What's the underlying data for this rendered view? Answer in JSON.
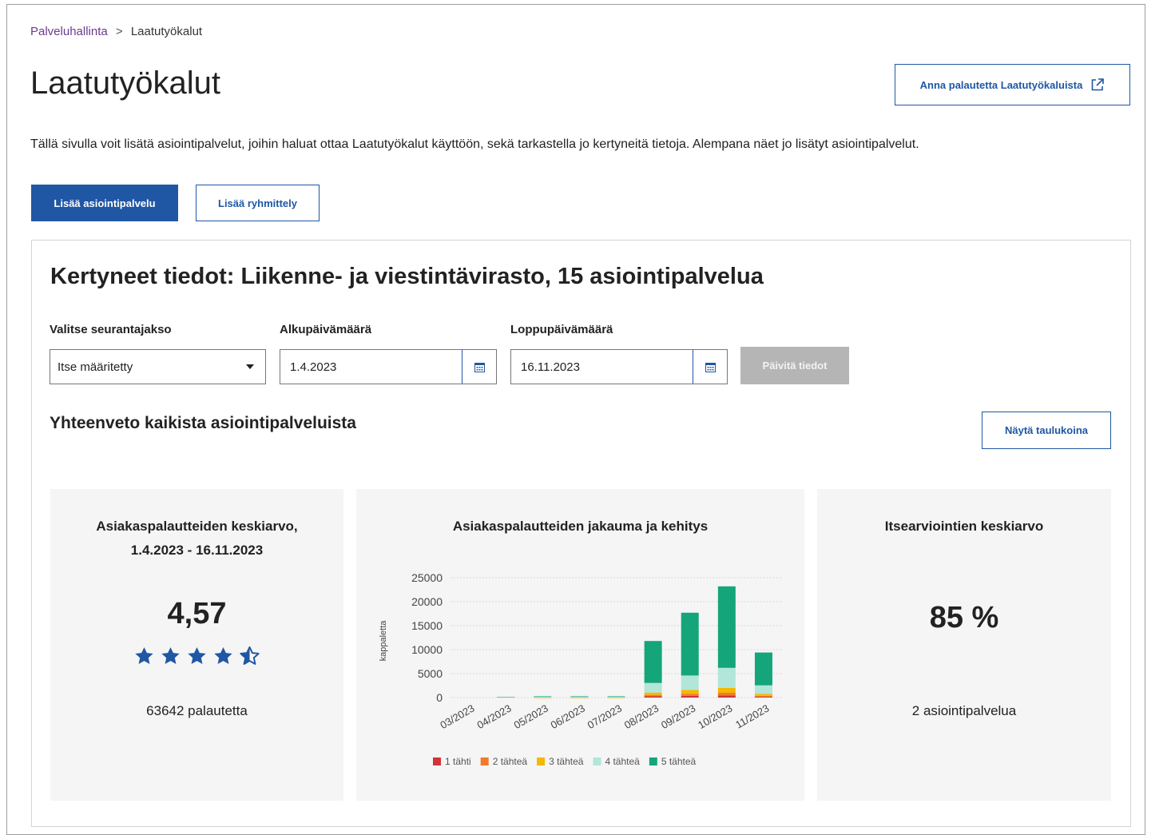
{
  "breadcrumb": {
    "parent": "Palveluhallinta",
    "separator": ">",
    "current": "Laatutyökalut"
  },
  "page": {
    "title": "Laatutyökalut",
    "feedback_button": "Anna palautetta Laatutyökaluista",
    "intro": "Tällä sivulla voit lisätä asiointipalvelut, joihin haluat ottaa Laatutyökalut käyttöön, sekä tarkastella jo kertyneitä tietoja. Alempana näet jo lisätyt asiointipalvelut."
  },
  "actions": {
    "add_service": "Lisää asiointipalvelu",
    "add_group": "Lisää ryhmittely"
  },
  "panel": {
    "title": "Kertyneet tiedot: Liikenne- ja viestintävirasto, 15 asiointipalvelua",
    "period_label": "Valitse seurantajakso",
    "period_value": "Itse määritetty",
    "start_label": "Alkupäivämäärä",
    "start_value": "1.4.2023",
    "end_label": "Loppupäivämäärä",
    "end_value": "16.11.2023",
    "update_button": "Päivitä tiedot",
    "summary_title": "Yhteenveto kaikista asiointipalveluista",
    "table_button": "Näytä taulukoina"
  },
  "cards": {
    "feedback_avg": {
      "title_line1": "Asiakaspalautteiden keskiarvo,",
      "title_line2": "1.4.2023 - 16.11.2023",
      "value": "4,57",
      "rating": 4.57,
      "count": "63642 palautetta"
    },
    "distribution": {
      "title": "Asiakaspalautteiden jakauma ja kehitys"
    },
    "self_eval": {
      "title": "Itsearviointien keskiarvo",
      "value": "85 %",
      "count": "2 asiointipalvelua"
    }
  },
  "colors": {
    "primary": "#1f57a4",
    "star": "#1f57a4",
    "breadcrumb_link": "#6b3b8c"
  },
  "chart_data": {
    "type": "bar",
    "stacked": true,
    "categories": [
      "03/2023",
      "04/2023",
      "05/2023",
      "06/2023",
      "07/2023",
      "08/2023",
      "09/2023",
      "10/2023",
      "11/2023"
    ],
    "ylabel": "kappaletta",
    "ylim": [
      0,
      25000
    ],
    "yticks": [
      "25000",
      "20000",
      "15000",
      "10000",
      "5000",
      "0"
    ],
    "legend_position": "bottom",
    "series": [
      {
        "name": "1 tähti",
        "color": "#d13438",
        "values": [
          0,
          0,
          5,
          5,
          5,
          250,
          350,
          450,
          150
        ]
      },
      {
        "name": "2 tähteä",
        "color": "#f07b2a",
        "values": [
          0,
          0,
          5,
          5,
          5,
          300,
          450,
          550,
          200
        ]
      },
      {
        "name": "3 tähteä",
        "color": "#f5b800",
        "values": [
          0,
          0,
          10,
          10,
          10,
          500,
          800,
          1000,
          400
        ]
      },
      {
        "name": "4 tähteä",
        "color": "#b2e6da",
        "values": [
          0,
          80,
          200,
          200,
          200,
          2000,
          3000,
          4200,
          1800
        ]
      },
      {
        "name": "5 tähteä",
        "color": "#15a57a",
        "values": [
          0,
          20,
          80,
          80,
          80,
          8750,
          13100,
          17000,
          6850
        ]
      }
    ]
  }
}
